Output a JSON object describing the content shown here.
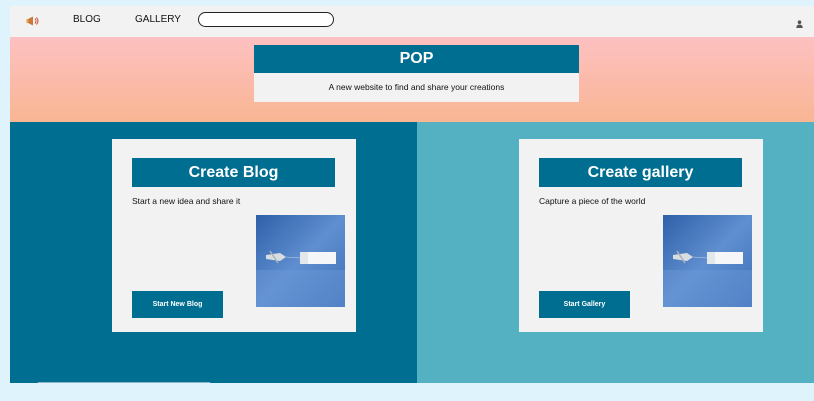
{
  "navbar": {
    "logo_icon": "megaphone-icon",
    "blog_label": "BLOG",
    "gallery_label": "GALLERY",
    "search_value": "",
    "user_icon": "user-icon"
  },
  "hero": {
    "title": "POP",
    "subtitle": "A new website to find and share your creations"
  },
  "cards": [
    {
      "title": "Create Blog",
      "description": "Start a new idea and share it",
      "button_label": "Start New Blog",
      "image_icon": "airplane-banner-image"
    },
    {
      "title": "Create gallery",
      "description": "Capture a piece of the world",
      "button_label": "Start Gallery",
      "image_icon": "airplane-banner-image"
    }
  ],
  "colors": {
    "primary": "#006e91",
    "secondary_panel": "#53b1c1",
    "hero_top": "#fdc1c1",
    "hero_bottom": "#f8b693",
    "card_bg": "#f2f2f2"
  }
}
